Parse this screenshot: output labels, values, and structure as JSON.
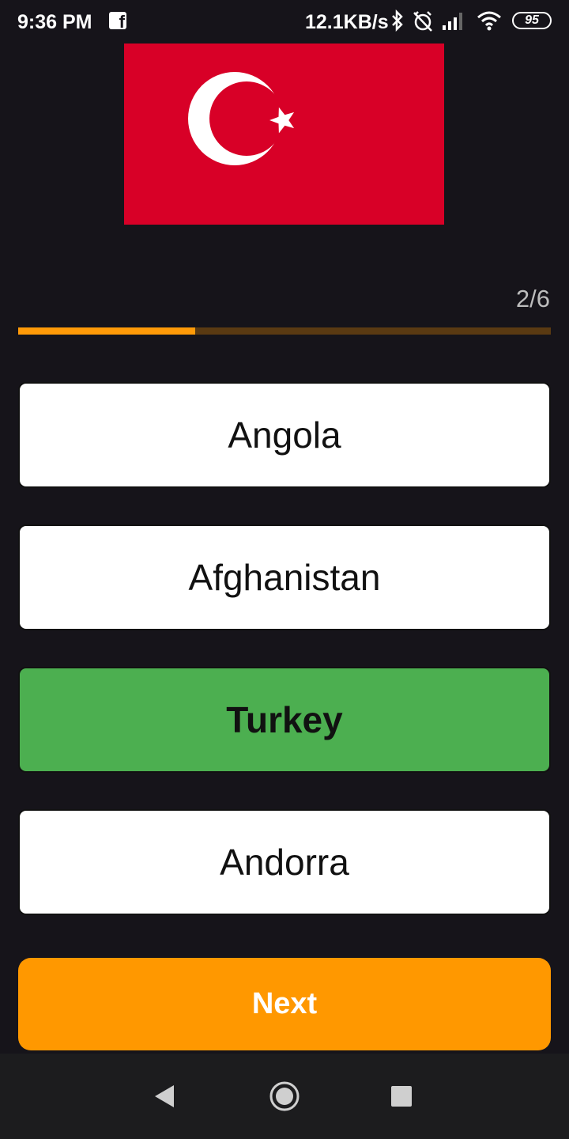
{
  "status_bar": {
    "time": "9:36 PM",
    "network_speed": "12.1KB/s",
    "battery": "95",
    "icons": [
      "facebook-icon",
      "bluetooth-icon",
      "alarm-off-icon",
      "signal-icon",
      "wifi-icon",
      "battery-icon"
    ]
  },
  "flag": {
    "country_shown": "turkey-flag",
    "color": "#d80027"
  },
  "progress": {
    "label": "2/6",
    "current": 2,
    "total": 6,
    "fraction": 0.333
  },
  "options": [
    {
      "label": "Angola",
      "state": "default"
    },
    {
      "label": "Afghanistan",
      "state": "default"
    },
    {
      "label": "Turkey",
      "state": "correct"
    },
    {
      "label": "Andorra",
      "state": "default"
    }
  ],
  "next_button": {
    "label": "Next"
  },
  "colors": {
    "background": "#16141a",
    "accent": "#ff9800",
    "correct": "#4caf50",
    "progress_track": "#5a3a12"
  },
  "nav_bar": {
    "icons": [
      "back-icon",
      "home-icon",
      "recents-icon"
    ]
  }
}
